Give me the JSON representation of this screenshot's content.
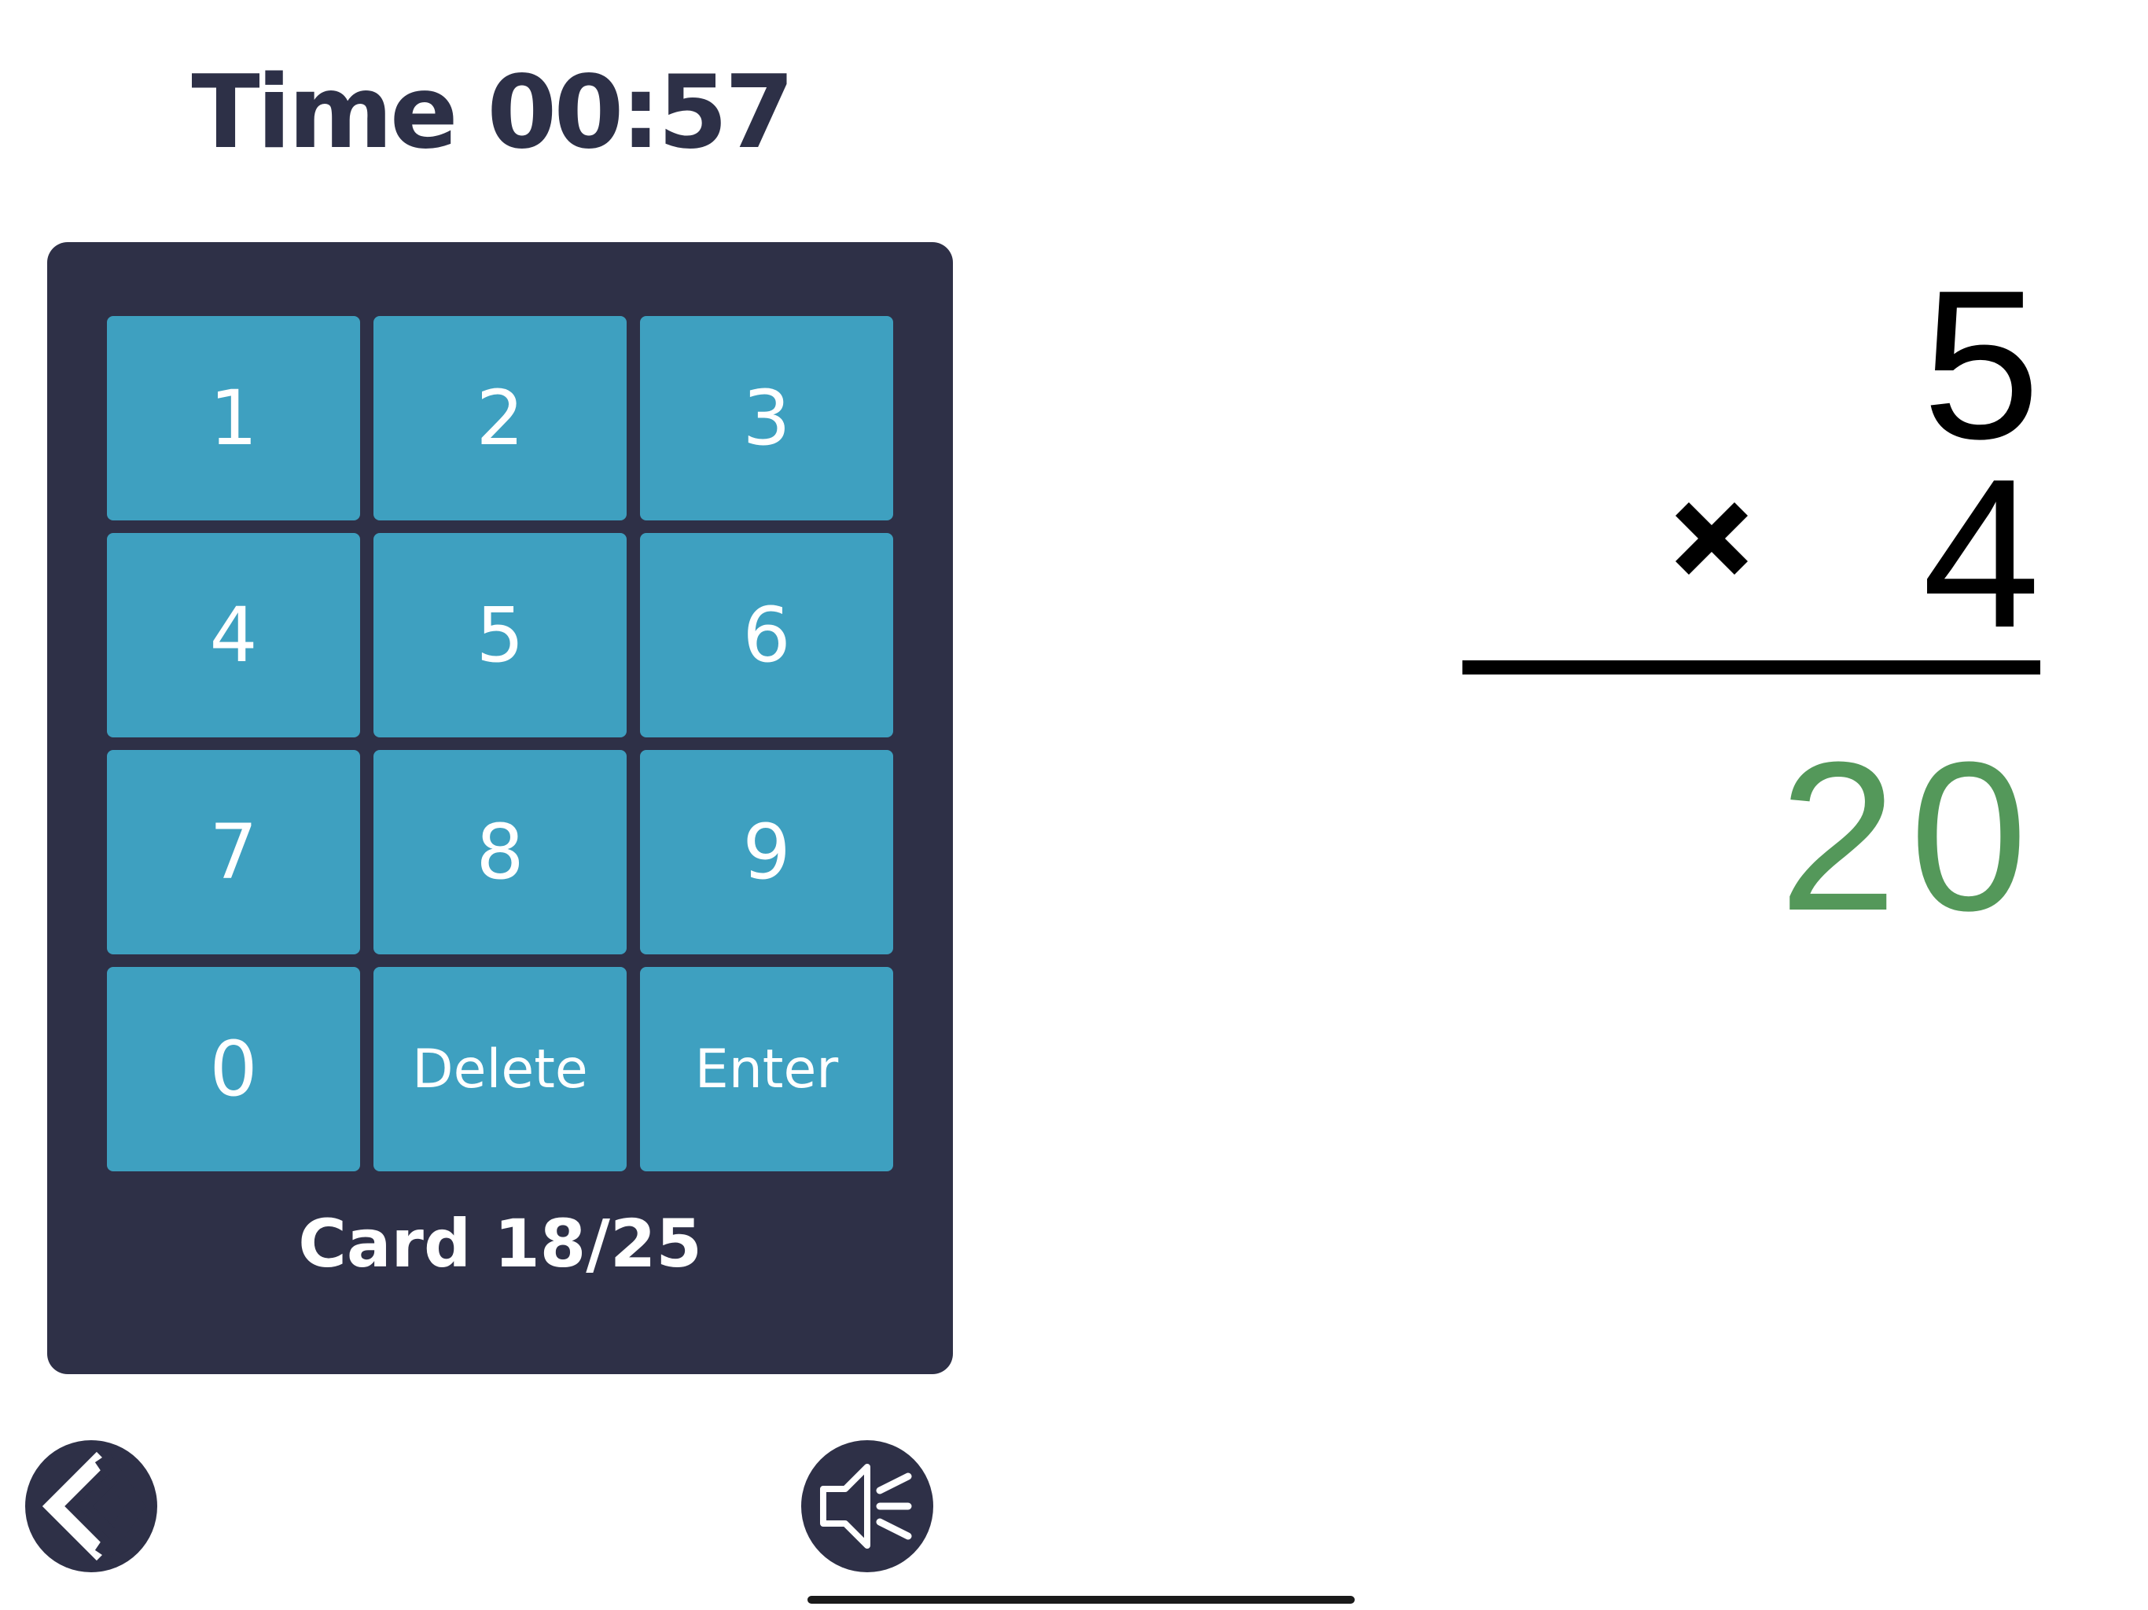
{
  "timer": {
    "text": "Time 00:57"
  },
  "keypad": {
    "keys": [
      {
        "label": "1"
      },
      {
        "label": "2"
      },
      {
        "label": "3"
      },
      {
        "label": "4"
      },
      {
        "label": "5"
      },
      {
        "label": "6"
      },
      {
        "label": "7"
      },
      {
        "label": "8"
      },
      {
        "label": "9"
      },
      {
        "label": "0"
      },
      {
        "label": "Delete"
      },
      {
        "label": "Enter"
      }
    ],
    "card_counter": "Card 18/25"
  },
  "problem": {
    "top_operand": "5",
    "bottom_operand": "4",
    "operator": "multiply-icon",
    "answer": "20",
    "answer_color": "#54985a"
  },
  "controls": {
    "back_icon": "back-arrow-icon",
    "sound_icon": "speaker-icon"
  },
  "colors": {
    "panel": "#2e3047",
    "key": "#3ea0c0",
    "text_dark": "#2d3047"
  }
}
